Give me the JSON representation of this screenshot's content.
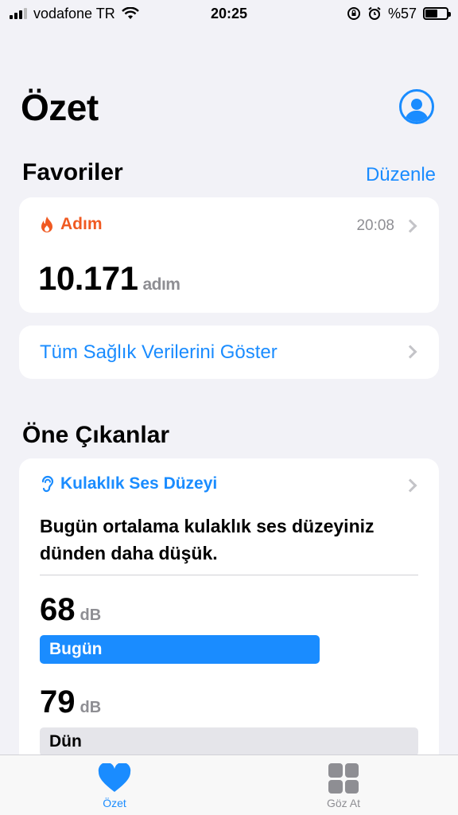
{
  "status_bar": {
    "carrier": "vodafone TR",
    "time": "20:25",
    "battery": "%57",
    "battery_level": 0.57
  },
  "header": {
    "title": "Özet"
  },
  "favorites": {
    "title": "Favoriler",
    "edit_label": "Düzenle",
    "step_card": {
      "title": "Adım",
      "time": "20:08",
      "value": "10.171",
      "unit": "adım"
    },
    "all_data_label": "Tüm Sağlık Verilerini Göster"
  },
  "highlights": {
    "title": "Öne Çıkanlar",
    "card": {
      "title": "Kulaklık Ses Düzeyi",
      "text": "Bugün ortalama kulaklık ses düzeyiniz dünden daha düşük.",
      "today": {
        "value": "68",
        "unit": "dB",
        "label": "Bugün"
      },
      "yesterday": {
        "value": "79",
        "unit": "dB",
        "label": "Dün"
      }
    }
  },
  "tab_bar": {
    "tabs": [
      {
        "label": "Özet",
        "icon": "heart-icon",
        "active": true
      },
      {
        "label": "Göz At",
        "icon": "grid-icon",
        "active": false
      }
    ]
  },
  "colors": {
    "accent": "#1a8cff",
    "activity": "#f05a22"
  }
}
